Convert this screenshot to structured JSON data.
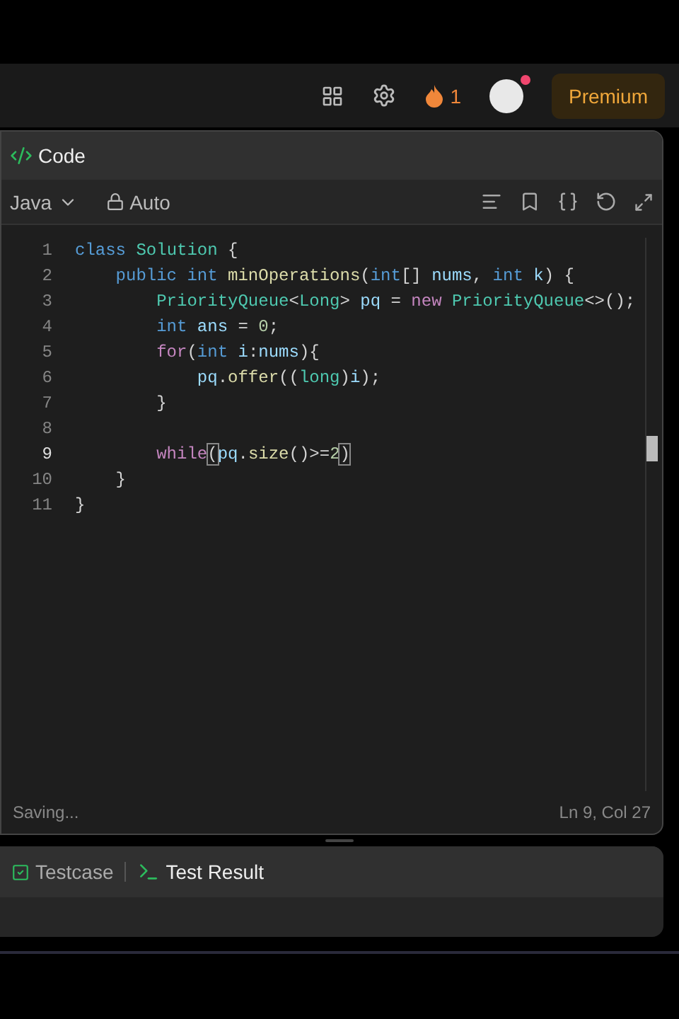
{
  "top_bar": {
    "streak": "1",
    "premium": "Premium",
    "avatar_notification": true
  },
  "code_panel": {
    "title": "Code",
    "language": "Java",
    "mode": "Auto",
    "lines": [
      {
        "number": "1",
        "selected": false,
        "tokens": [
          {
            "text": "class",
            "kind": "decl"
          },
          {
            "text": " Solution",
            "kind": "type"
          },
          {
            "text": " {",
            "kind": "plain"
          }
        ]
      },
      {
        "number": "2",
        "selected": false,
        "tokens": [
          {
            "text": "    public",
            "kind": "decl"
          },
          {
            "text": " int",
            "kind": "decl"
          },
          {
            "text": " minOperations",
            "kind": "method"
          },
          {
            "text": "(",
            "kind": "plain"
          },
          {
            "text": "int",
            "kind": "decl"
          },
          {
            "text": "[] ",
            "kind": "plain"
          },
          {
            "text": "nums",
            "kind": "var"
          },
          {
            "text": ", ",
            "kind": "plain"
          },
          {
            "text": "int",
            "kind": "decl"
          },
          {
            "text": " k",
            "kind": "var"
          },
          {
            "text": ") {",
            "kind": "plain"
          }
        ]
      },
      {
        "number": "3",
        "selected": false,
        "tokens": [
          {
            "text": "        PriorityQueue",
            "kind": "type"
          },
          {
            "text": "<",
            "kind": "plain"
          },
          {
            "text": "Long",
            "kind": "type"
          },
          {
            "text": "> ",
            "kind": "plain"
          },
          {
            "text": "pq",
            "kind": "var"
          },
          {
            "text": " = ",
            "kind": "plain"
          },
          {
            "text": "new",
            "kind": "control"
          },
          {
            "text": " PriorityQueue",
            "kind": "type"
          },
          {
            "text": "<>();",
            "kind": "plain"
          }
        ]
      },
      {
        "number": "4",
        "selected": false,
        "tokens": [
          {
            "text": "        int",
            "kind": "decl"
          },
          {
            "text": " ans",
            "kind": "var"
          },
          {
            "text": " = ",
            "kind": "plain"
          },
          {
            "text": "0",
            "kind": "number"
          },
          {
            "text": ";",
            "kind": "plain"
          }
        ]
      },
      {
        "number": "5",
        "selected": false,
        "tokens": [
          {
            "text": "        for",
            "kind": "control"
          },
          {
            "text": "(",
            "kind": "plain"
          },
          {
            "text": "int",
            "kind": "decl"
          },
          {
            "text": " i",
            "kind": "var"
          },
          {
            "text": ":",
            "kind": "plain"
          },
          {
            "text": "nums",
            "kind": "var"
          },
          {
            "text": "){",
            "kind": "plain"
          }
        ]
      },
      {
        "number": "6",
        "selected": false,
        "tokens": [
          {
            "text": "            pq",
            "kind": "var"
          },
          {
            "text": ".",
            "kind": "plain"
          },
          {
            "text": "offer",
            "kind": "method"
          },
          {
            "text": "((",
            "kind": "plain"
          },
          {
            "text": "long",
            "kind": "type"
          },
          {
            "text": ")",
            "kind": "plain"
          },
          {
            "text": "i",
            "kind": "var"
          },
          {
            "text": ");",
            "kind": "plain"
          }
        ]
      },
      {
        "number": "7",
        "selected": false,
        "tokens": [
          {
            "text": "        }",
            "kind": "plain"
          }
        ]
      },
      {
        "number": "8",
        "selected": false
      },
      {
        "number": "9",
        "selected": true,
        "tokens": [
          {
            "text": "        while",
            "kind": "control"
          },
          {
            "text": "(",
            "kind": "match"
          },
          {
            "text": "pq",
            "kind": "var"
          },
          {
            "text": ".",
            "kind": "plain"
          },
          {
            "text": "size",
            "kind": "method"
          },
          {
            "text": "()>=",
            "kind": "plain"
          },
          {
            "text": "2",
            "kind": "number"
          },
          {
            "text": ")",
            "kind": "match"
          }
        ]
      },
      {
        "number": "10",
        "selected": false,
        "tokens": [
          {
            "text": "    }",
            "kind": "plain"
          }
        ]
      },
      {
        "number": "11",
        "selected": false,
        "tokens": [
          {
            "text": "}",
            "kind": "plain"
          }
        ]
      }
    ],
    "status": "Saving...",
    "cursor": "Ln 9, Col 27"
  },
  "bottom_panel": {
    "tabs": [
      {
        "label": "Testcase",
        "selected": false,
        "kind": "testcase"
      },
      {
        "label": "Test Result",
        "selected": true,
        "kind": "result"
      }
    ]
  }
}
